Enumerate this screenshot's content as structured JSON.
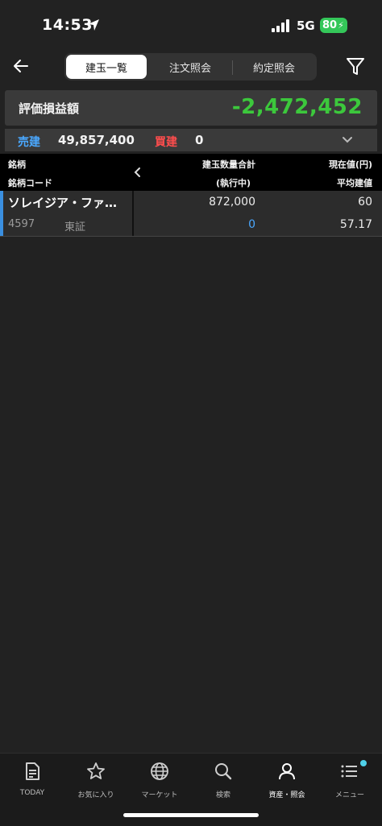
{
  "status": {
    "time": "14:53",
    "network": "5G",
    "battery": "80"
  },
  "header": {
    "tabs": [
      {
        "label": "建玉一覧",
        "active": true
      },
      {
        "label": "注文照会",
        "active": false
      },
      {
        "label": "約定照会",
        "active": false
      }
    ]
  },
  "summary": {
    "pl_label": "評価損益額",
    "pl_value": "-2,472,452",
    "sell_label": "売建",
    "sell_value": "49,857,400",
    "buy_label": "買建",
    "buy_value": "0"
  },
  "table": {
    "headers": {
      "name": "銘柄",
      "code": "銘柄コード",
      "qty_total": "建玉数量合計",
      "executing": "(執行中)",
      "current_price": "現在値(円)",
      "avg_price": "平均建値"
    },
    "rows": [
      {
        "name": "ソレイジア・ファ…",
        "code": "4597",
        "market": "東証",
        "qty": "872,000",
        "executing": "0",
        "price": "60",
        "avg": "57.17"
      }
    ]
  },
  "tabbar": {
    "items": [
      {
        "label": "TODAY",
        "icon": "document-icon"
      },
      {
        "label": "お気に入り",
        "icon": "star-icon"
      },
      {
        "label": "マーケット",
        "icon": "globe-icon"
      },
      {
        "label": "検索",
        "icon": "search-icon"
      },
      {
        "label": "資産・照会",
        "icon": "person-icon",
        "active": true
      },
      {
        "label": "メニュー",
        "icon": "menu-icon"
      }
    ]
  },
  "colors": {
    "positive_green": "#3cc83c",
    "sell_blue": "#4aa8ff",
    "buy_red": "#ff4d4d",
    "accent_blue": "#3a8fe0"
  }
}
